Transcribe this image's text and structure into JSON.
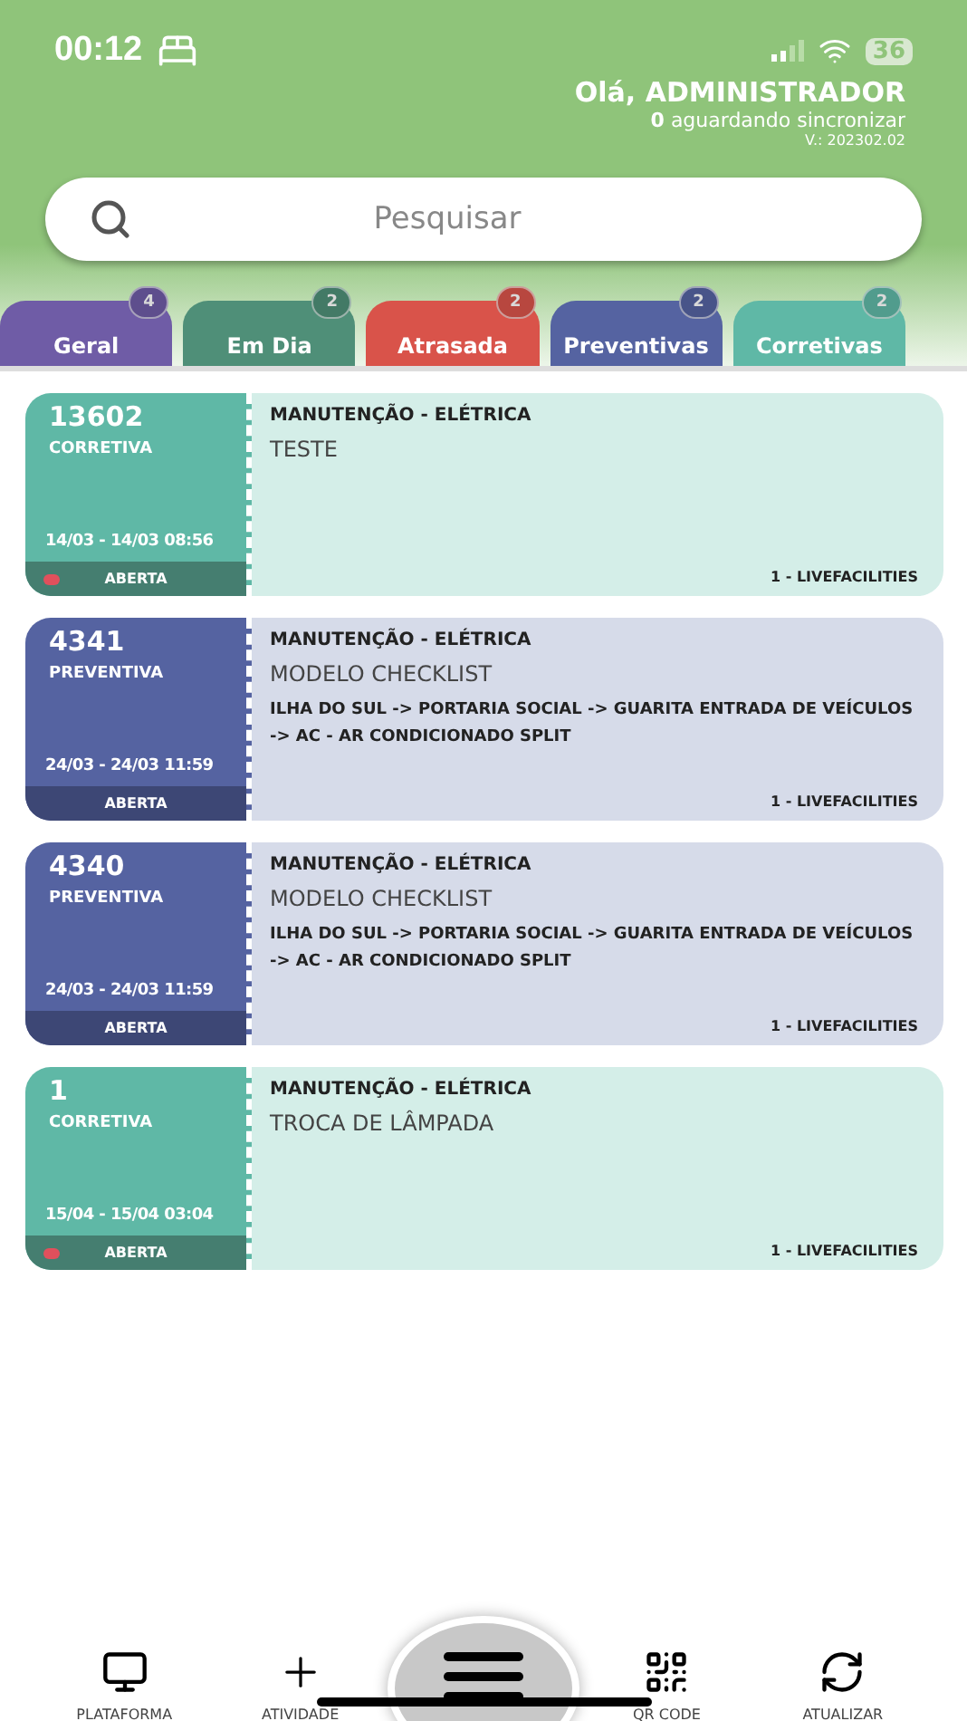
{
  "status_bar": {
    "time": "00:12",
    "battery": "36"
  },
  "header": {
    "greeting": "Olá, ADMINISTRADOR",
    "sync_count": "0",
    "sync_text": "aguardando sincronizar",
    "version": "V.: 202302.02"
  },
  "search": {
    "placeholder": "Pesquisar"
  },
  "tabs": [
    {
      "label": "Geral",
      "count": "4",
      "color": "#6f5ca6"
    },
    {
      "label": "Em Dia",
      "count": "2",
      "color": "#4f8f78"
    },
    {
      "label": "Atrasada",
      "count": "2",
      "color": "#d9534a"
    },
    {
      "label": "Preventivas",
      "count": "2",
      "color": "#5563a1"
    },
    {
      "label": "Corretivas",
      "count": "2",
      "color": "#5fb8a6"
    }
  ],
  "cards": [
    {
      "kind": "corretiva",
      "number": "13602",
      "type": "CORRETIVA",
      "dates": "14/03 - 14/03 08:56",
      "status": "ABERTA",
      "flagged": true,
      "category": "MANUTENÇÃO - ELÉTRICA",
      "title": "TESTE",
      "company": "1 - LIVEFACILITIES"
    },
    {
      "kind": "preventiva",
      "number": "4341",
      "type": "PREVENTIVA",
      "dates": "24/03 - 24/03 11:59",
      "status": "ABERTA",
      "flagged": false,
      "category": "MANUTENÇÃO - ELÉTRICA",
      "title": "MODELO CHECKLIST",
      "location": "ILHA DO SUL -> PORTARIA SOCIAL -> GUARITA ENTRADA DE VEÍCULOS -> AC - AR CONDICIONADO SPLIT",
      "company": "1 - LIVEFACILITIES"
    },
    {
      "kind": "preventiva",
      "number": "4340",
      "type": "PREVENTIVA",
      "dates": "24/03 - 24/03 11:59",
      "status": "ABERTA",
      "flagged": false,
      "category": "MANUTENÇÃO - ELÉTRICA",
      "title": "MODELO CHECKLIST",
      "location": "ILHA DO SUL -> PORTARIA SOCIAL -> GUARITA ENTRADA DE VEÍCULOS -> AC - AR CONDICIONADO SPLIT",
      "company": "1 - LIVEFACILITIES"
    },
    {
      "kind": "corretiva",
      "number": "1",
      "type": "CORRETIVA",
      "dates": "15/04 - 15/04 03:04",
      "status": "ABERTA",
      "flagged": true,
      "category": "MANUTENÇÃO - ELÉTRICA",
      "title": "TROCA DE LÂMPADA",
      "company": "1 - LIVEFACILITIES"
    }
  ],
  "nav": [
    {
      "kind": "monitor",
      "label": "PLATAFORMA"
    },
    {
      "kind": "plus",
      "label": "ATIVIDADE"
    },
    {
      "kind": "menu"
    },
    {
      "kind": "qr",
      "label": "QR CODE"
    },
    {
      "kind": "refresh",
      "label": "ATUALIZAR"
    }
  ]
}
